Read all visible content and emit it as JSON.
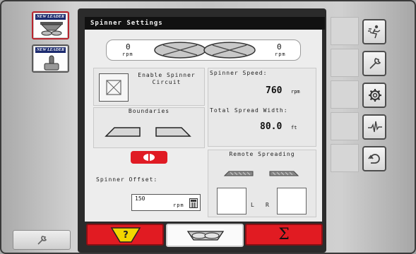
{
  "app_tiles": [
    {
      "logo_text": "NEW LEADER",
      "icon": "spreader-app-icon",
      "selected": true
    },
    {
      "logo_text": "NEW LEADER",
      "icon": "joystick-app-icon",
      "selected": false
    }
  ],
  "screen": {
    "title": "Spinner Settings"
  },
  "spinners": {
    "left_rpm": "0",
    "right_rpm": "0",
    "unit": "rpm"
  },
  "enable": {
    "label": "Enable Spinner Circuit",
    "checked": false
  },
  "speed": {
    "label": "Spinner Speed:",
    "value": "760",
    "unit": "rpm"
  },
  "spread_width": {
    "label": "Total Spread Width:",
    "value": "80.0",
    "unit": "ft"
  },
  "boundaries": {
    "label": "Boundaries"
  },
  "offset": {
    "label": "Spinner Offset:",
    "value": "150",
    "unit": "rpm"
  },
  "remote": {
    "label": "Remote Spreading",
    "left_label": "L",
    "right_label": "R"
  },
  "tabs": [
    {
      "name": "help-tab",
      "icon": "help-bin-icon",
      "active": false
    },
    {
      "name": "spinner-tab",
      "icon": "spinner-icon",
      "active": true
    },
    {
      "name": "totals-tab",
      "label": "Σ",
      "active": false
    }
  ],
  "side_buttons": [
    "run-icon",
    "wrench-icon",
    "gear-icon",
    "diagnostics-icon",
    "back-icon"
  ],
  "colors": {
    "accent_red": "#e11b22",
    "help_yellow": "#f2d600",
    "title_bar": "#111111"
  }
}
